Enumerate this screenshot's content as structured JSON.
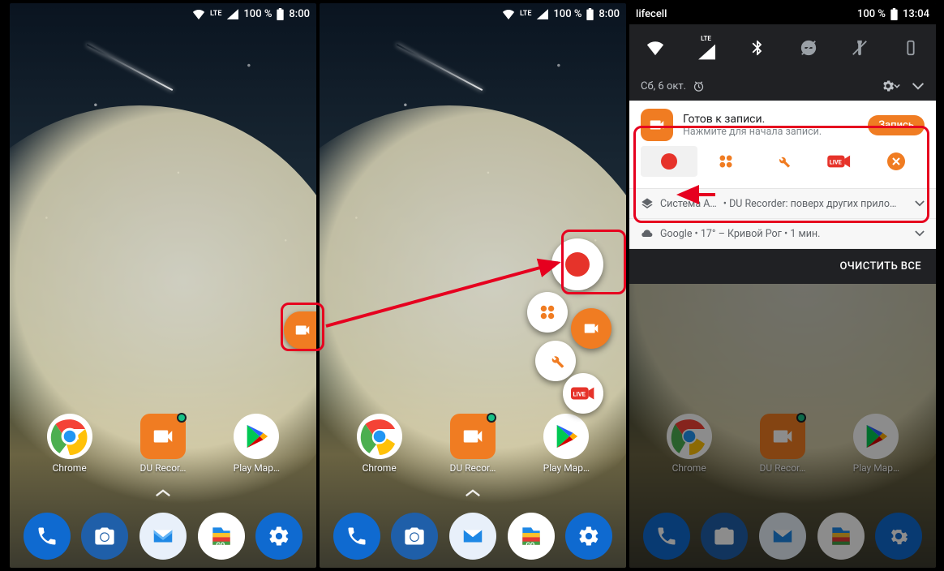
{
  "status": {
    "battery": "100 %",
    "time_1_2": "8:00",
    "time_3": "13:04",
    "net_label": "LTE",
    "carrier": "lifecell"
  },
  "apps": {
    "chrome": "Chrome",
    "du": "DU Recor…",
    "play": "Play Мар…"
  },
  "shade": {
    "date": "Сб, 6 окт.",
    "du_title": "Готов к записи.",
    "du_sub": "Нажмите для начала записи.",
    "record_btn": "Запись",
    "sys_left": "Система А…",
    "sys_right": "DU Recorder: поверх других прило…",
    "weather": "Google • 17° – Кривой Рог • 1 мин.",
    "clear_all": "ОЧИСТИТЬ ВСЕ"
  },
  "icons": {
    "wifi": "wifi-icon",
    "lte": "lte",
    "signal": "signal-icon",
    "battery": "battery-icon",
    "bt": "bluetooth-icon",
    "dnd": "dnd-icon",
    "flash": "flashlight-icon",
    "portrait": "portrait-icon",
    "alarm": "alarm-icon",
    "gear": "gear-icon",
    "chevron": "chevron-down-icon",
    "camera": "camera-icon",
    "record": "record-icon",
    "grid": "grid-icon",
    "tools": "tools-icon",
    "live": "live-icon",
    "close": "close-icon",
    "layers": "layers-icon",
    "cloud": "cloud-icon",
    "phone": "phone-icon",
    "cam2": "camera-app-icon",
    "inbox": "inbox-icon",
    "files": "files-icon",
    "settings": "settings-icon",
    "chrome": "chrome-icon",
    "du": "du-recorder-icon",
    "play": "play-store-icon",
    "up": "chevron-up-icon"
  }
}
